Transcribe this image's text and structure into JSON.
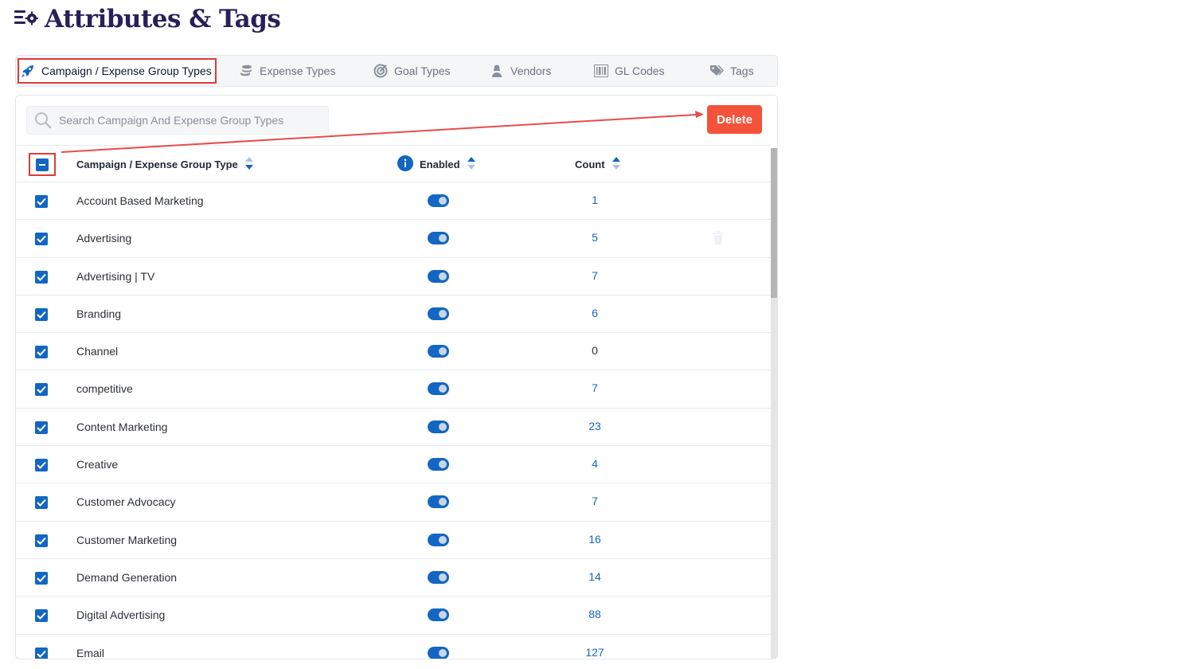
{
  "page": {
    "title": "Attributes & Tags"
  },
  "tabs": [
    {
      "label": "Campaign / Expense Group Types",
      "icon": "rocket-icon",
      "active": true
    },
    {
      "label": "Expense Types",
      "icon": "coins-icon",
      "active": false
    },
    {
      "label": "Goal Types",
      "icon": "target-icon",
      "active": false
    },
    {
      "label": "Vendors",
      "icon": "person-icon",
      "active": false
    },
    {
      "label": "GL Codes",
      "icon": "barcode-icon",
      "active": false
    },
    {
      "label": "Tags",
      "icon": "tags-icon",
      "active": false
    }
  ],
  "search": {
    "placeholder": "Search Campaign And Expense Group Types",
    "value": ""
  },
  "toolbar": {
    "delete_label": "Delete"
  },
  "table": {
    "columns": {
      "name": "Campaign / Expense Group Type",
      "enabled": "Enabled",
      "count": "Count"
    },
    "header_checkbox_state": "indeterminate",
    "rows": [
      {
        "name": "Account Based Marketing",
        "enabled": true,
        "count": "1",
        "checked": true
      },
      {
        "name": "Advertising",
        "enabled": true,
        "count": "5",
        "checked": true
      },
      {
        "name": "Advertising | TV",
        "enabled": true,
        "count": "7",
        "checked": true
      },
      {
        "name": "Branding",
        "enabled": true,
        "count": "6",
        "checked": true
      },
      {
        "name": "Channel",
        "enabled": true,
        "count": "0",
        "checked": true
      },
      {
        "name": "competitive",
        "enabled": true,
        "count": "7",
        "checked": true
      },
      {
        "name": "Content Marketing",
        "enabled": true,
        "count": "23",
        "checked": true
      },
      {
        "name": "Creative",
        "enabled": true,
        "count": "4",
        "checked": true
      },
      {
        "name": "Customer Advocacy",
        "enabled": true,
        "count": "7",
        "checked": true
      },
      {
        "name": "Customer Marketing",
        "enabled": true,
        "count": "16",
        "checked": true
      },
      {
        "name": "Demand Generation",
        "enabled": true,
        "count": "14",
        "checked": true
      },
      {
        "name": "Digital Advertising",
        "enabled": true,
        "count": "88",
        "checked": true
      },
      {
        "name": "Email",
        "enabled": true,
        "count": "127",
        "checked": true
      }
    ]
  },
  "colors": {
    "accent": "#1366c2",
    "delete": "#f4523b",
    "title": "#2a1f5a",
    "highlight": "#e03a3a"
  }
}
